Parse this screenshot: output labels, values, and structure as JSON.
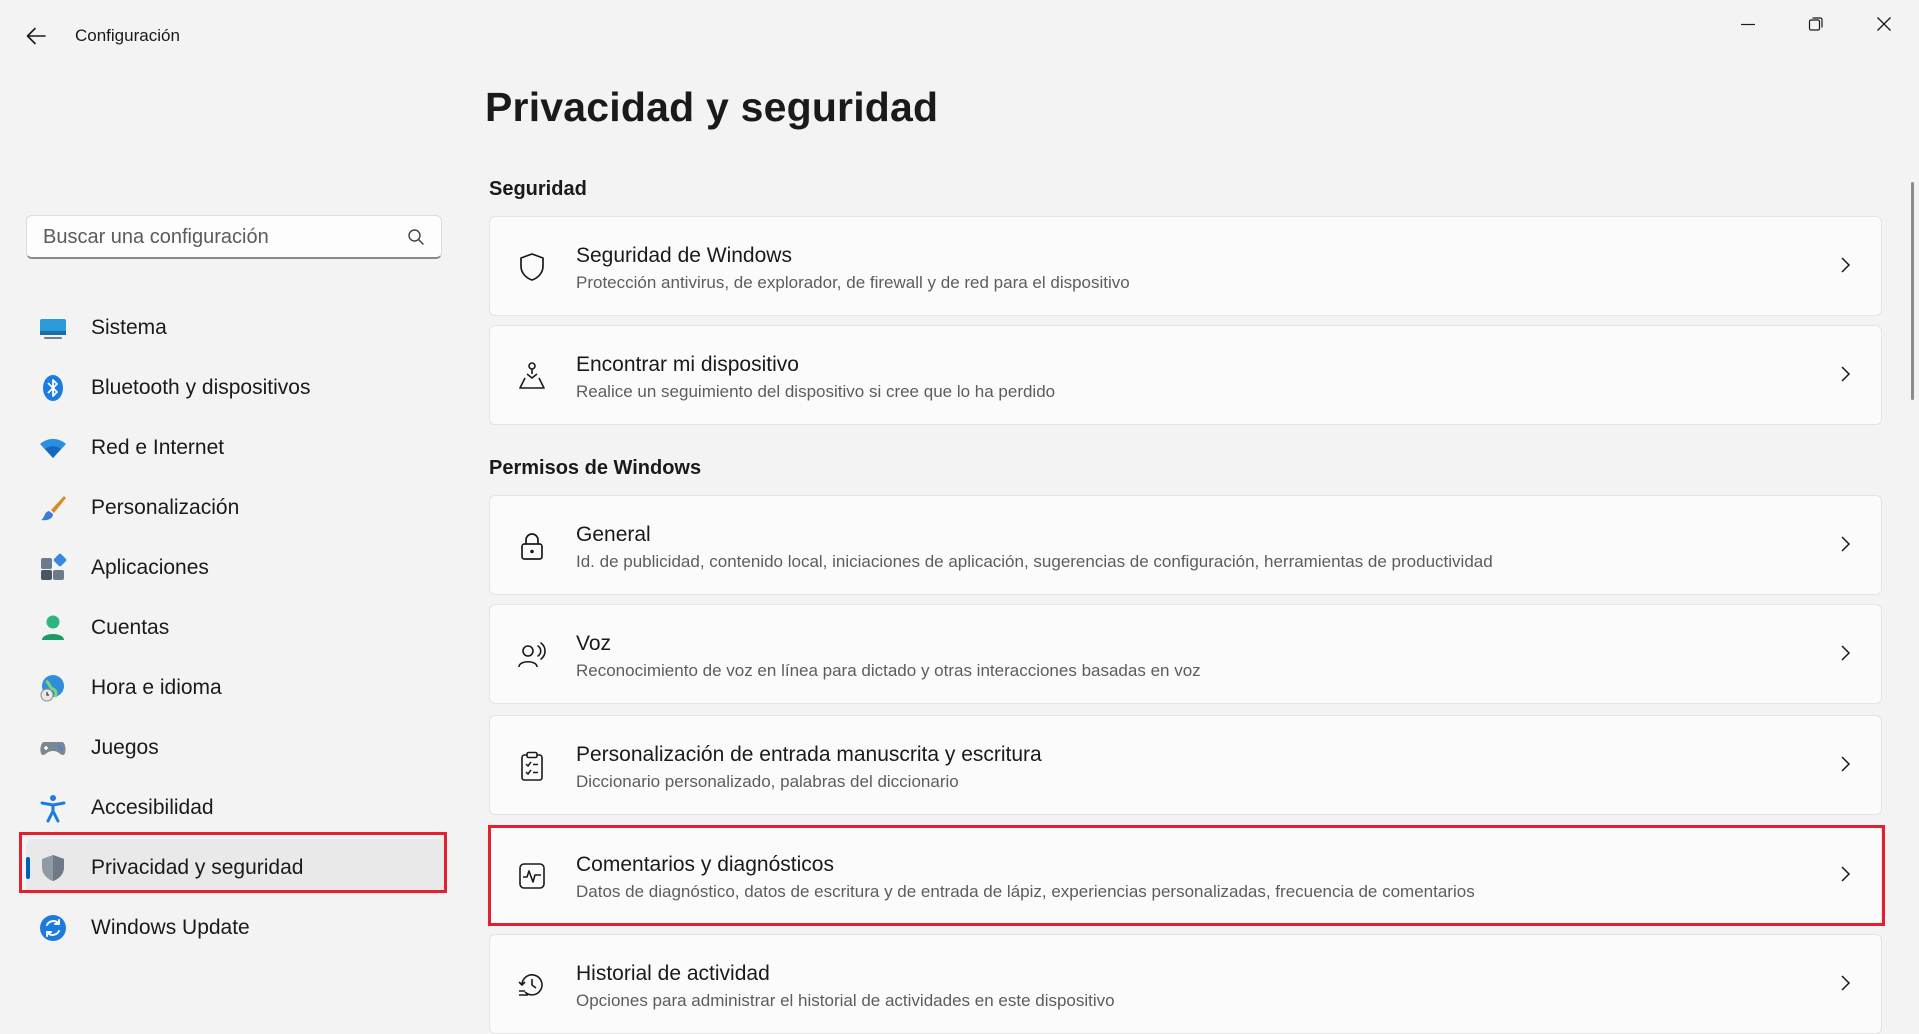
{
  "window": {
    "title": "Configuración",
    "controls": {
      "minimize": "minimize-icon",
      "maximize": "restore-icon",
      "close": "close-icon"
    }
  },
  "search": {
    "placeholder": "Buscar una configuración",
    "value": ""
  },
  "sidebar": {
    "items": [
      {
        "label": "Sistema",
        "icon": "system-monitor-icon"
      },
      {
        "label": "Bluetooth y dispositivos",
        "icon": "bluetooth-icon"
      },
      {
        "label": "Red e Internet",
        "icon": "wifi-icon"
      },
      {
        "label": "Personalización",
        "icon": "paintbrush-icon"
      },
      {
        "label": "Aplicaciones",
        "icon": "apps-grid-icon"
      },
      {
        "label": "Cuentas",
        "icon": "person-icon"
      },
      {
        "label": "Hora e idioma",
        "icon": "globe-clock-icon"
      },
      {
        "label": "Juegos",
        "icon": "gamepad-icon"
      },
      {
        "label": "Accesibilidad",
        "icon": "accessibility-icon"
      },
      {
        "label": "Privacidad y seguridad",
        "icon": "shield-icon",
        "active": true
      },
      {
        "label": "Windows Update",
        "icon": "update-icon"
      }
    ]
  },
  "main": {
    "title": "Privacidad y seguridad",
    "sections": [
      {
        "title": "Seguridad",
        "cards": [
          {
            "title": "Seguridad de Windows",
            "desc": "Protección antivirus, de explorador, de firewall y de red para el dispositivo",
            "icon": "shield-outline-icon"
          },
          {
            "title": "Encontrar mi dispositivo",
            "desc": "Realice un seguimiento del dispositivo si cree que lo ha perdido",
            "icon": "location-person-icon"
          }
        ]
      },
      {
        "title": "Permisos de Windows",
        "cards": [
          {
            "title": "General",
            "desc": "Id. de publicidad, contenido local, iniciaciones de aplicación, sugerencias de configuración, herramientas de productividad",
            "icon": "lock-icon"
          },
          {
            "title": "Voz",
            "desc": "Reconocimiento de voz en línea para dictado y otras interacciones basadas en voz",
            "icon": "voice-person-icon"
          },
          {
            "title": "Personalización de entrada manuscrita y escritura",
            "desc": "Diccionario personalizado, palabras del diccionario",
            "icon": "clipboard-checklist-icon"
          },
          {
            "title": "Comentarios y diagnósticos",
            "desc": "Datos de diagnóstico, datos de escritura y de entrada de lápiz, experiencias personalizadas, frecuencia de comentarios",
            "icon": "diagnostics-pulse-icon",
            "highlighted": true
          },
          {
            "title": "Historial de actividad",
            "desc": "Opciones para administrar el historial de actividades en este dispositivo",
            "icon": "history-icon"
          }
        ]
      }
    ]
  },
  "colors": {
    "accent": "#005fb8",
    "highlight": "#e3202f",
    "background": "#f3f3f3",
    "card": "#fbfbfb"
  }
}
